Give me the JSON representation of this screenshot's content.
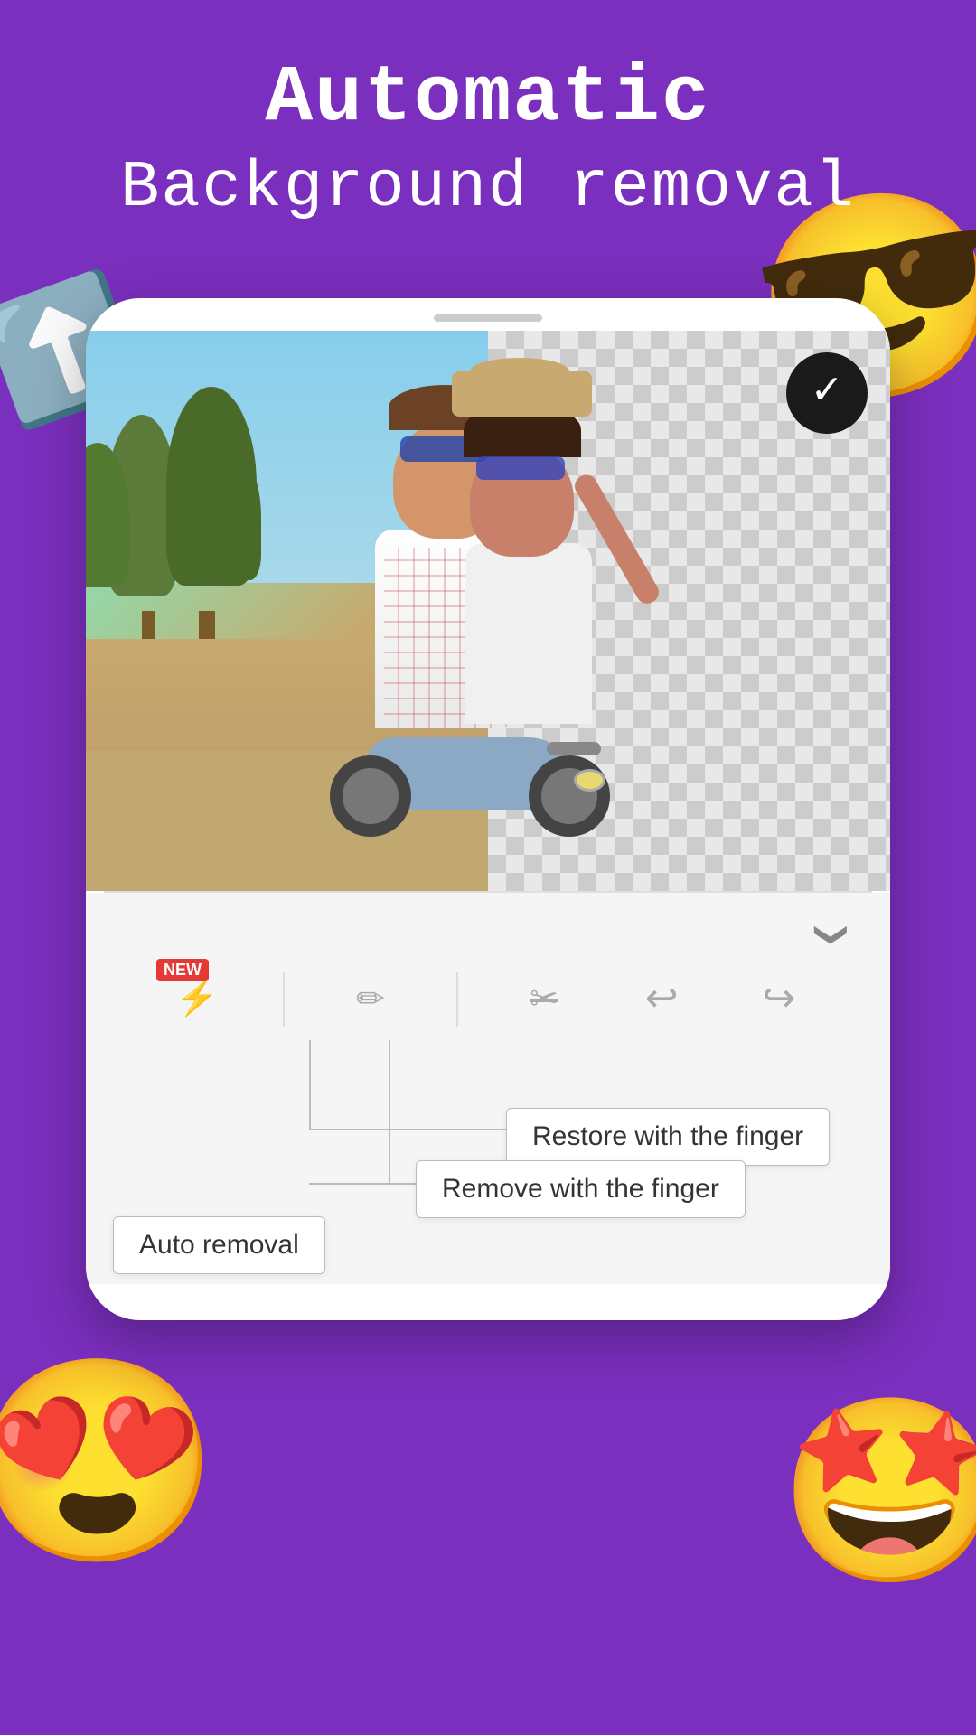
{
  "title": {
    "line1": "Automatic",
    "line2": "Background removal"
  },
  "checkmark": "✓",
  "toolbar": {
    "new_badge": "NEW",
    "tools": [
      {
        "name": "wand",
        "icon": "⚡",
        "label": "Auto"
      },
      {
        "name": "brush",
        "icon": "✏",
        "label": "Restore brush"
      },
      {
        "name": "eraser",
        "icon": "✂",
        "label": "Erase brush"
      },
      {
        "name": "undo",
        "icon": "↩",
        "label": "Undo"
      },
      {
        "name": "redo",
        "icon": "↪",
        "label": "Redo"
      }
    ]
  },
  "tooltips": {
    "restore": "Restore with the finger",
    "remove": "Remove with the finger",
    "auto": "Auto removal"
  },
  "emojis": {
    "cool": "😎",
    "heart_eyes": "😍",
    "star_struck": "🤩"
  },
  "decorations": {
    "arrow": "⬆"
  },
  "chevron_down": "❯"
}
